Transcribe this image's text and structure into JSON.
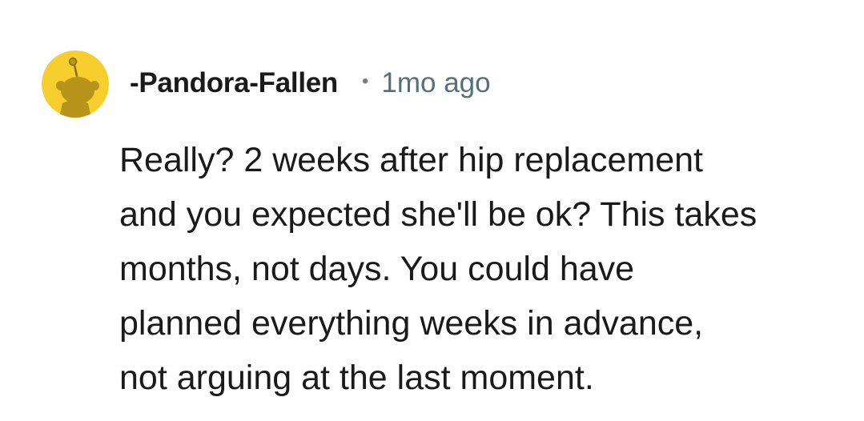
{
  "comment": {
    "author": "-Pandora-Fallen",
    "separator": "•",
    "timestamp": "1mo ago",
    "avatar_icon": "snoo-avatar-icon",
    "avatar_color": "#f6cf2e",
    "lines": [
      "Really? 2 weeks after hip replacement",
      "and you expected she'll be ok? This takes",
      "months, not days. You could have",
      "planned everything weeks in advance,",
      "not arguing at the last moment."
    ]
  }
}
